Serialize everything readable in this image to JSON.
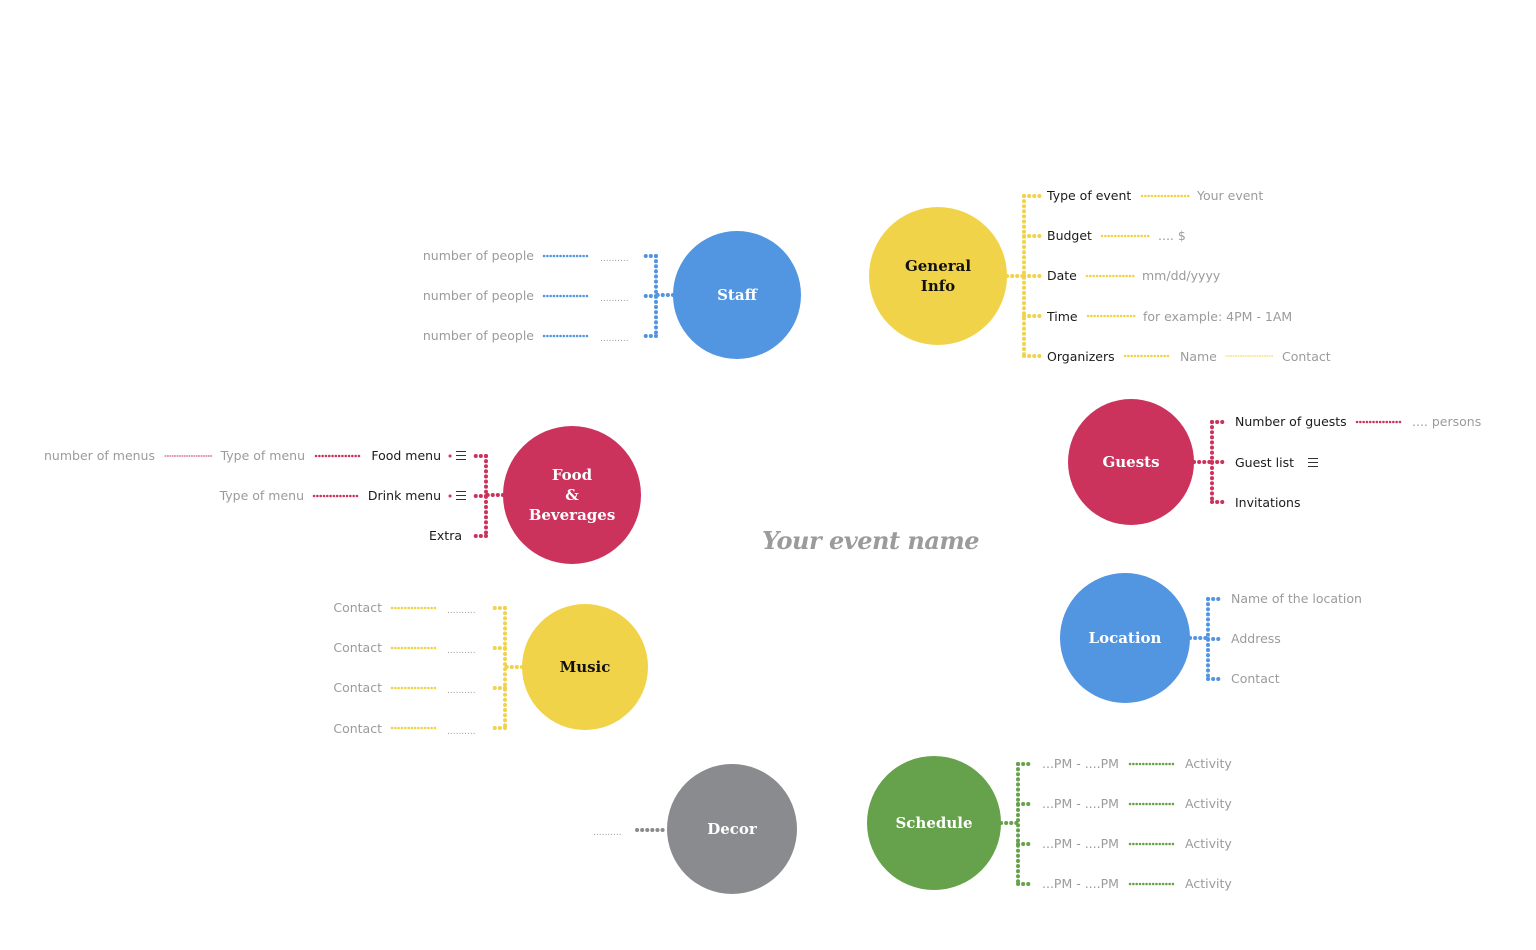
{
  "title": "Your event name",
  "colors": {
    "yellow": "#f1d34a",
    "blue": "#5295e1",
    "crimson": "#cb335c",
    "green": "#66a14c",
    "gray": "#8a8b8e",
    "text_dark": "#1b1b1b",
    "text_light": "#9b9b9b"
  },
  "nodes": {
    "general_info": {
      "label": "General\nInfo",
      "color": "yellow",
      "branches": [
        {
          "label": "Type of event",
          "value": "Your event"
        },
        {
          "label": "Budget",
          "value": ".... $"
        },
        {
          "label": "Date",
          "value": "mm/dd/yyyy"
        },
        {
          "label": "Time",
          "value": "for example: 4PM - 1AM"
        },
        {
          "label": "Organizers",
          "value": "Name",
          "extra": "Contact"
        }
      ]
    },
    "staff": {
      "label": "Staff",
      "color": "blue",
      "branches": [
        {
          "placeholder": "..........",
          "value": "number of people"
        },
        {
          "placeholder": "..........",
          "value": "number of people"
        },
        {
          "placeholder": "..........",
          "value": "number of people"
        }
      ]
    },
    "food": {
      "label": "Food\n&\nBeverages",
      "color": "crimson",
      "branches": [
        {
          "label": "Food menu",
          "icon": "list-icon",
          "value": "Type of menu",
          "extra": "number of menus"
        },
        {
          "label": "Drink menu",
          "icon": "list-icon",
          "value": "Type of menu"
        },
        {
          "label": "Extra"
        }
      ]
    },
    "guests": {
      "label": "Guests",
      "color": "crimson",
      "branches": [
        {
          "label": "Number of guests",
          "value": ".... persons"
        },
        {
          "label": "Guest list",
          "icon": "list-icon"
        },
        {
          "label": "Invitations"
        }
      ]
    },
    "music": {
      "label": "Music",
      "color": "yellow",
      "branches": [
        {
          "placeholder": "..........",
          "value": "Contact"
        },
        {
          "placeholder": "..........",
          "value": "Contact"
        },
        {
          "placeholder": "..........",
          "value": "Contact"
        },
        {
          "placeholder": "..........",
          "value": "Contact"
        }
      ]
    },
    "location": {
      "label": "Location",
      "color": "blue",
      "branches": [
        {
          "value": "Name of the location"
        },
        {
          "value": "Address"
        },
        {
          "value": "Contact"
        }
      ]
    },
    "schedule": {
      "label": "Schedule",
      "color": "green",
      "branches": [
        {
          "value": "...PM - ....PM",
          "extra": "Activity"
        },
        {
          "value": "...PM - ....PM",
          "extra": "Activity"
        },
        {
          "value": "...PM - ....PM",
          "extra": "Activity"
        },
        {
          "value": "...PM - ....PM",
          "extra": "Activity"
        }
      ]
    },
    "decor": {
      "label": "Decor",
      "color": "gray",
      "placeholder": ".........."
    }
  }
}
